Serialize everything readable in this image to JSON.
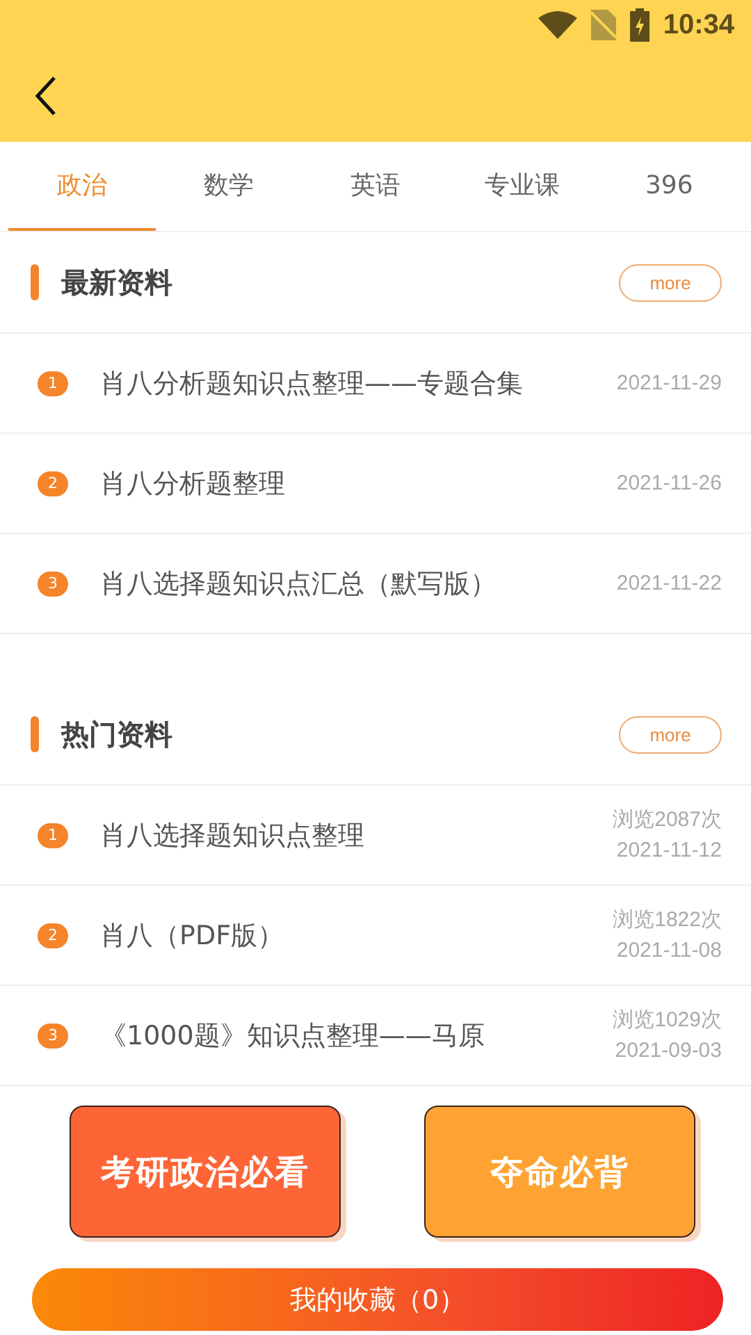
{
  "status_bar": {
    "time": "10:34"
  },
  "tabs": [
    {
      "label": "政治",
      "selected": true
    },
    {
      "label": "数学",
      "selected": false
    },
    {
      "label": "英语",
      "selected": false
    },
    {
      "label": "专业课",
      "selected": false
    },
    {
      "label": "396",
      "selected": false
    }
  ],
  "sections": [
    {
      "title": "最新资料",
      "more": "more",
      "items": [
        {
          "rank": "1",
          "title": "肖八分析题知识点整理——专题合集",
          "date": "2021-11-29"
        },
        {
          "rank": "2",
          "title": "肖八分析题整理",
          "date": "2021-11-26"
        },
        {
          "rank": "3",
          "title": "肖八选择题知识点汇总（默写版）",
          "date": "2021-11-22"
        }
      ]
    },
    {
      "title": "热门资料",
      "more": "more",
      "items": [
        {
          "rank": "1",
          "title": "肖八选择题知识点整理",
          "views": "浏览2087次",
          "date": "2021-11-12"
        },
        {
          "rank": "2",
          "title": "肖八（PDF版）",
          "views": "浏览1822次",
          "date": "2021-11-08"
        },
        {
          "rank": "3",
          "title": "《1000题》知识点整理——马原",
          "views": "浏览1029次",
          "date": "2021-09-03"
        }
      ]
    }
  ],
  "cards": [
    {
      "label": "考研政治必看",
      "color": "#fd6536"
    },
    {
      "label": "夺命必背",
      "color": "#fea333"
    }
  ],
  "favorites_button": "我的收藏（0）"
}
